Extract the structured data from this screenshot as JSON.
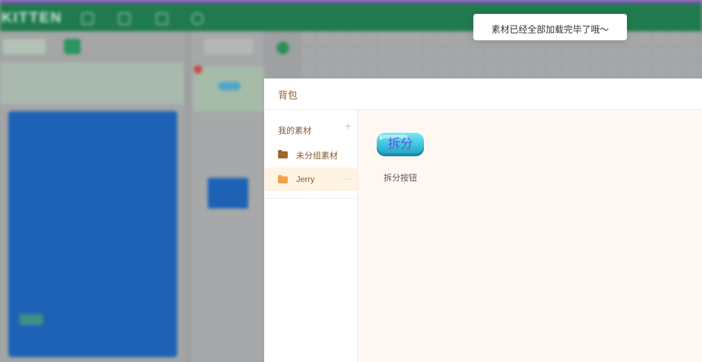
{
  "background": {
    "app_logo": "KITTEN"
  },
  "backpack": {
    "title": "背包",
    "sidebar": {
      "heading": "我的素材",
      "add_icon": "plus-icon",
      "folders": [
        {
          "label": "未分组素材",
          "icon": "folder-icon",
          "color": "#a0652b"
        },
        {
          "label": "Jerry",
          "icon": "folder-icon",
          "color": "#f0a24a",
          "selected": true,
          "more_icon": "ellipsis-icon"
        }
      ]
    },
    "assets": [
      {
        "label": "拆分按钮",
        "thumbnail_text": "拆分"
      }
    ]
  },
  "toast": {
    "message": "素材已经全部加载完毕了哦～"
  },
  "colors": {
    "topbar": "#1f7a4d",
    "dialog_title": "#8a5a2a",
    "selected_bg": "#fff4e3",
    "content_bg": "#fff8f2",
    "asset_button": "#3fc6e0"
  }
}
